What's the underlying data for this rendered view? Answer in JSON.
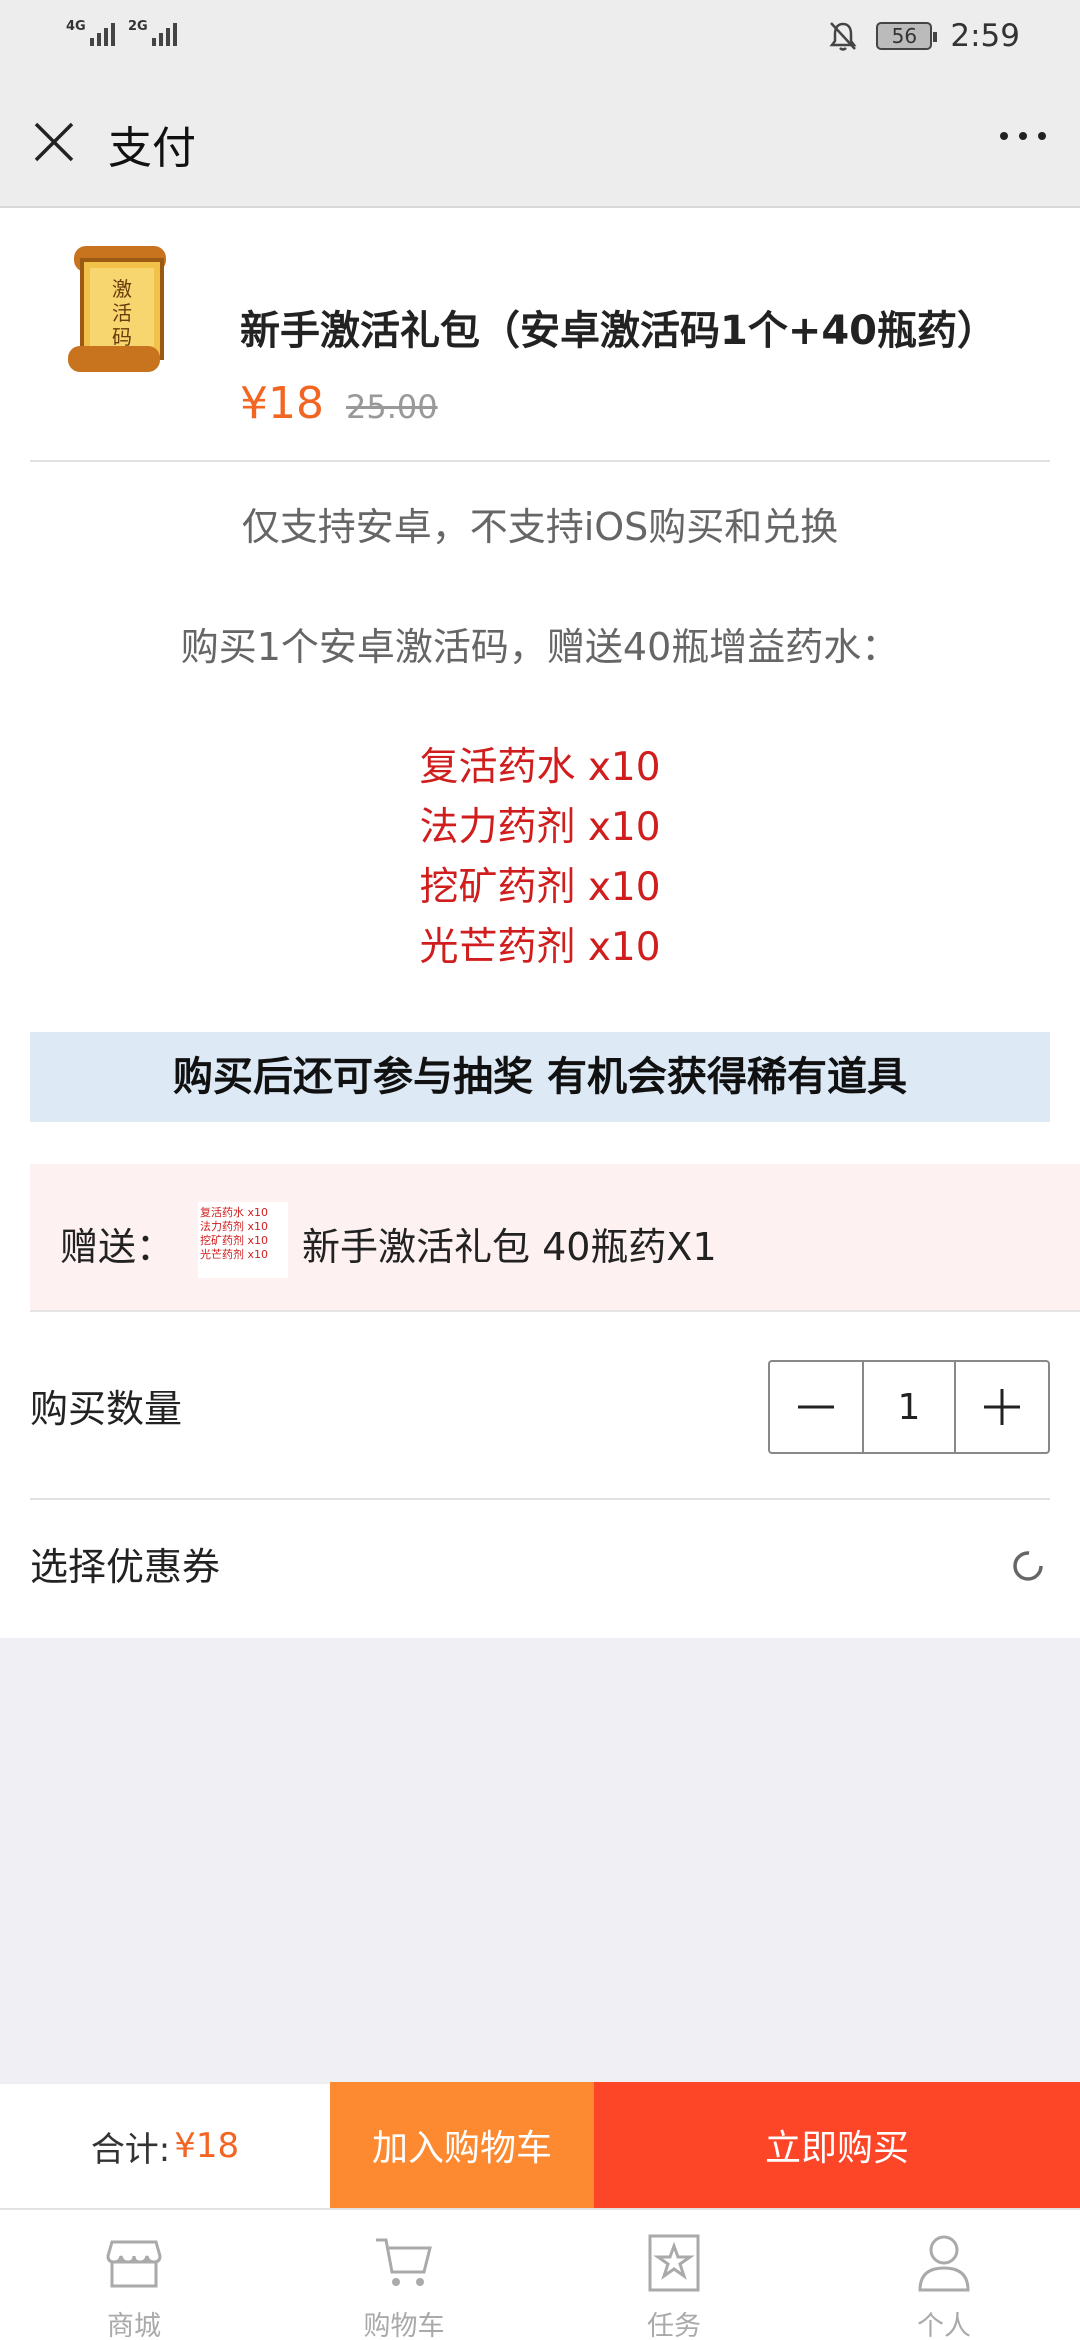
{
  "status_bar": {
    "signal1_label": "4G",
    "signal2_label": "2G",
    "battery": "56",
    "time": "2:59"
  },
  "nav": {
    "title": "支付",
    "close_icon": "close-icon",
    "more_icon": "more-icon"
  },
  "product": {
    "image_text": "激活码",
    "name": "新手激活礼包（安卓激活码1个+40瓶药）",
    "price": "¥18",
    "original_price": "25.00"
  },
  "description": {
    "line1": "仅支持安卓，不支持iOS购买和兑换",
    "line2": "购买1个安卓激活码，赠送40瓶增益药水：",
    "potions": [
      "复活药水 x10",
      "法力药剂 x10",
      "挖矿药剂 x10",
      "光芒药剂 x10"
    ]
  },
  "banner": "购买后还可参与抽奖 有机会获得稀有道具",
  "gift": {
    "label": "赠送：",
    "thumb_lines": [
      "复活药水 x10",
      "法力药剂 x10",
      "挖矿药剂 x10",
      "光芒药剂 x10"
    ],
    "name": "新手激活礼包 40瓶药X1"
  },
  "quantity": {
    "label": "购买数量",
    "value": "1"
  },
  "coupon": {
    "label": "选择优惠券"
  },
  "buy_bar": {
    "total_label": "合计:",
    "total_amount": "¥18",
    "add_to_cart": "加入购物车",
    "buy_now": "立即购买"
  },
  "tabs": [
    {
      "label": "商城",
      "icon": "store-icon"
    },
    {
      "label": "购物车",
      "icon": "cart-icon"
    },
    {
      "label": "任务",
      "icon": "task-icon"
    },
    {
      "label": "个人",
      "icon": "user-icon"
    }
  ],
  "colors": {
    "price": "#f26522",
    "potion_red": "#d01d1d",
    "add_cart_bg": "#fd8a30",
    "buy_now_bg": "#fd4528",
    "banner_bg": "#ddeaf5",
    "gift_bg": "#fdf2f1"
  }
}
